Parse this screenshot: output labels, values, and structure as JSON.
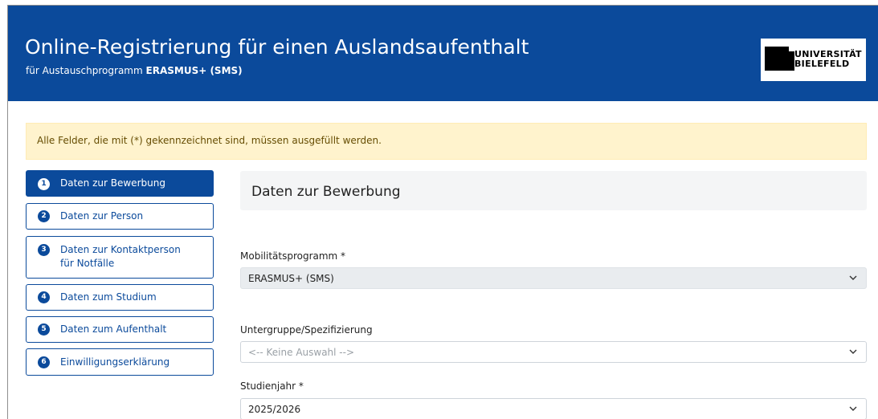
{
  "header": {
    "title": "Online-Registrierung für einen Auslandsaufenthalt",
    "subtitle_prefix": "für Austauschprogramm",
    "subtitle_program": "ERASMUS+ (SMS)",
    "logo_line1": "UNIVERSITÄT",
    "logo_line2": "BIELEFELD"
  },
  "alert": {
    "text": "Alle Felder, die mit (*) gekennzeichnet sind, müssen ausgefüllt werden."
  },
  "steps": [
    {
      "num": "1",
      "label": "Daten zur Bewerbung",
      "active": true
    },
    {
      "num": "2",
      "label": "Daten zur Person",
      "active": false
    },
    {
      "num": "3",
      "label_line1": "Daten zur Kontaktperson",
      "label_line2": "für Notfälle",
      "active": false
    },
    {
      "num": "4",
      "label": "Daten zum Studium",
      "active": false
    },
    {
      "num": "5",
      "label": "Daten zum Aufenthalt",
      "active": false
    },
    {
      "num": "6",
      "label": "Einwilligungserklärung",
      "active": false
    }
  ],
  "section": {
    "title": "Daten zur Bewerbung"
  },
  "fields": {
    "mobility": {
      "label": "Mobilitätsprogramm *",
      "value": "ERASMUS+ (SMS)"
    },
    "subgroup": {
      "label": "Untergruppe/Spezifizierung",
      "value": "<-- Keine Auswahl -->"
    },
    "studyyear": {
      "label": "Studienjahr *",
      "value": "2025/2026"
    }
  },
  "colors": {
    "brand": "#0b4a9b",
    "alert_bg": "#fff3cd",
    "alert_text": "#664d03"
  },
  "icons": [
    "chevron-down-icon"
  ]
}
